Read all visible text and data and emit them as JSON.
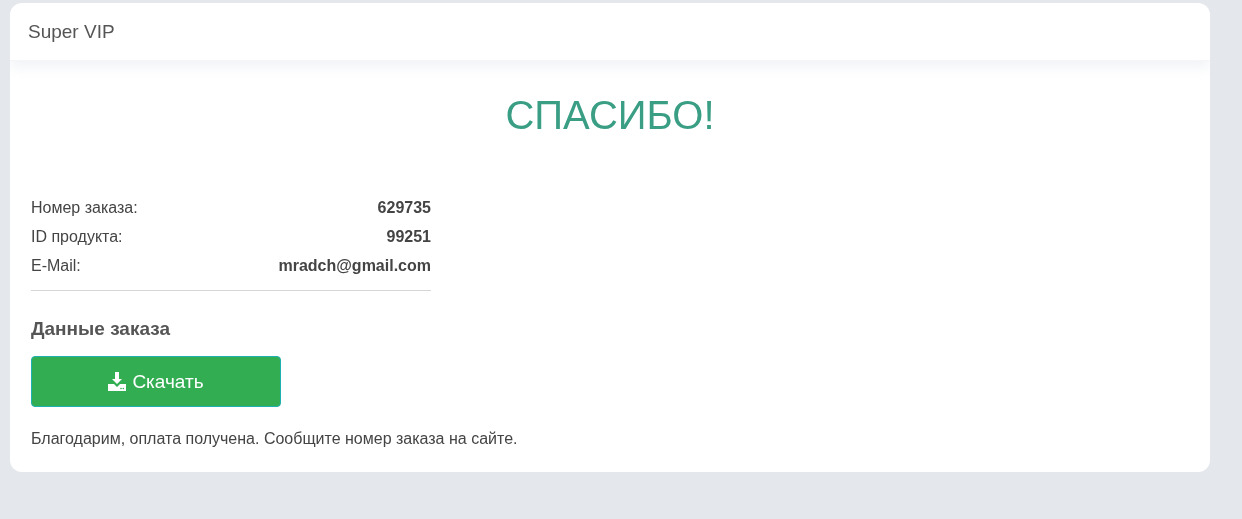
{
  "card": {
    "title": "Super VIP"
  },
  "heading": "СПАСИБО!",
  "details": [
    {
      "label": "Номер заказа:",
      "value": "629735"
    },
    {
      "label": "ID продукта:",
      "value": "99251"
    },
    {
      "label": "E-Mail:",
      "value": "mradch@gmail.com"
    }
  ],
  "section_title": "Данные заказа",
  "download_button": {
    "label": "Скачать"
  },
  "message": "Благодарим, оплата получена. Сообщите номер заказа на сайте."
}
